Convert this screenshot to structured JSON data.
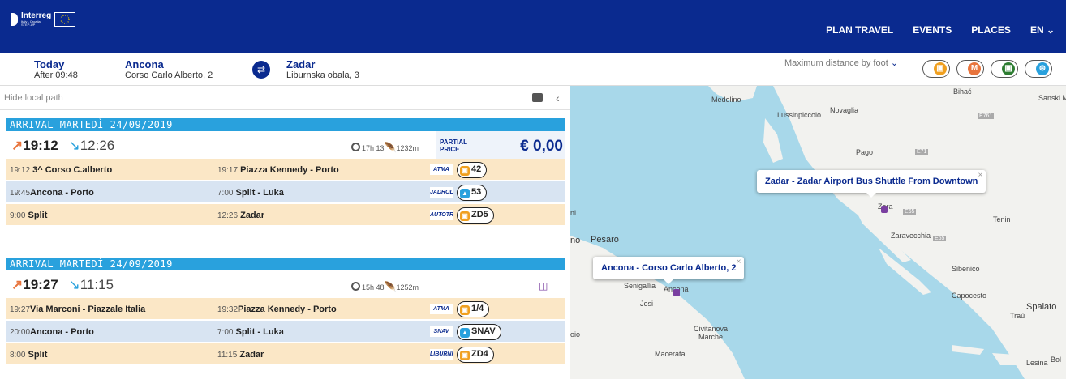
{
  "brand": {
    "name": "Interreg",
    "line2": "Italy - Croatia",
    "line3": "STEP-UP"
  },
  "nav": {
    "plan_travel": "PLAN TRAVEL",
    "events": "EVENTS",
    "places": "PLACES",
    "lang": "EN"
  },
  "search": {
    "when_title": "Today",
    "when_sub": "After 09:48",
    "from_title": "Ancona",
    "from_sub": "Corso Carlo Alberto, 2",
    "to_title": "Zadar",
    "to_sub": "Liburnska obala, 3",
    "max_distance": "Maximum distance by foot"
  },
  "modes": [
    {
      "name": "bus",
      "color": "#f0a020",
      "glyph": ""
    },
    {
      "name": "metro",
      "color": "#e8743c",
      "glyph": "M"
    },
    {
      "name": "train",
      "color": "#2e7d32",
      "glyph": ""
    },
    {
      "name": "ferry",
      "color": "#29a1dd",
      "glyph": ""
    }
  ],
  "panel": {
    "hide_local": "Hide local path"
  },
  "results": [
    {
      "arrival": "ARRIVAL MARTEDÌ 24/09/2019",
      "dep": "19:12",
      "arr": "12:26",
      "duration": "17h 13",
      "walk": "1232m",
      "price_label": "PARTIAL PRICE",
      "price": "€ 0,00",
      "legs": [
        {
          "t1": "19:12",
          "from": "3^ Corso C.alberto",
          "t2": "19:17",
          "to": "Piazza Kennedy - Porto",
          "op": "ATMA",
          "line": "42",
          "kind": "bus"
        },
        {
          "t1": "19:45",
          "from": "Ancona - Porto",
          "t2": "7:00",
          "to": "Split - Luka",
          "op": "JADROLINIJA",
          "line": "53",
          "kind": "ferry"
        },
        {
          "t1": "9:00",
          "from": "Split",
          "t2": "12:26",
          "to": "Zadar",
          "op": "AUTOTRANS",
          "line": "ZD5",
          "kind": "bus"
        }
      ]
    },
    {
      "arrival": "ARRIVAL MARTEDÌ 24/09/2019",
      "dep": "19:27",
      "arr": "11:15",
      "duration": "15h 48",
      "walk": "1252m",
      "legs": [
        {
          "t1": "19:27",
          "from": "Via Marconi - Piazzale Italia",
          "t2": "19:32",
          "to": "Piazza Kennedy - Porto",
          "op": "ATMA",
          "line": "1/4",
          "kind": "bus"
        },
        {
          "t1": "20:00",
          "from": "Ancona - Porto",
          "t2": "7:00",
          "to": "Split - Luka",
          "op": "SNAV",
          "line": "SNAV",
          "kind": "ferry"
        },
        {
          "t1": "8:00",
          "from": "Split",
          "t2": "11:15",
          "to": "Zadar",
          "op": "LIBURNIJA",
          "line": "ZD4",
          "kind": "bus"
        }
      ]
    }
  ],
  "map": {
    "popup_zadar": "Zadar - Zadar Airport Bus Shuttle From Downtown",
    "popup_ancona": "Ancona - Corso Carlo Alberto, 2",
    "labels": {
      "medolino": "Medolino",
      "lussinpiccolo": "Lussinpiccolo",
      "novaglia": "Novaglia",
      "pago": "Pago",
      "bihac": "Bihać",
      "sanski": "Sanski M",
      "zara": "Zara",
      "tenin": "Tenin",
      "zaravecchia": "Zaravecchia",
      "pesaro": "Pesaro",
      "senigallia": "Senigallia",
      "ancona": "Ancona",
      "jesi": "Jesi",
      "civitanova": "Civitanova Marche",
      "macerata": "Macerata",
      "sibenico": "Sibenico",
      "capocesto": "Capocesto",
      "spalato": "Spalato",
      "trau": "Traù",
      "lesina": "Lesina",
      "bol": "Bol",
      "no": "no",
      "ni": "ni",
      "oio": "oio"
    },
    "roads": {
      "e761": "E761",
      "e71": "E71",
      "e65a": "E65",
      "e65b": "E65"
    }
  }
}
